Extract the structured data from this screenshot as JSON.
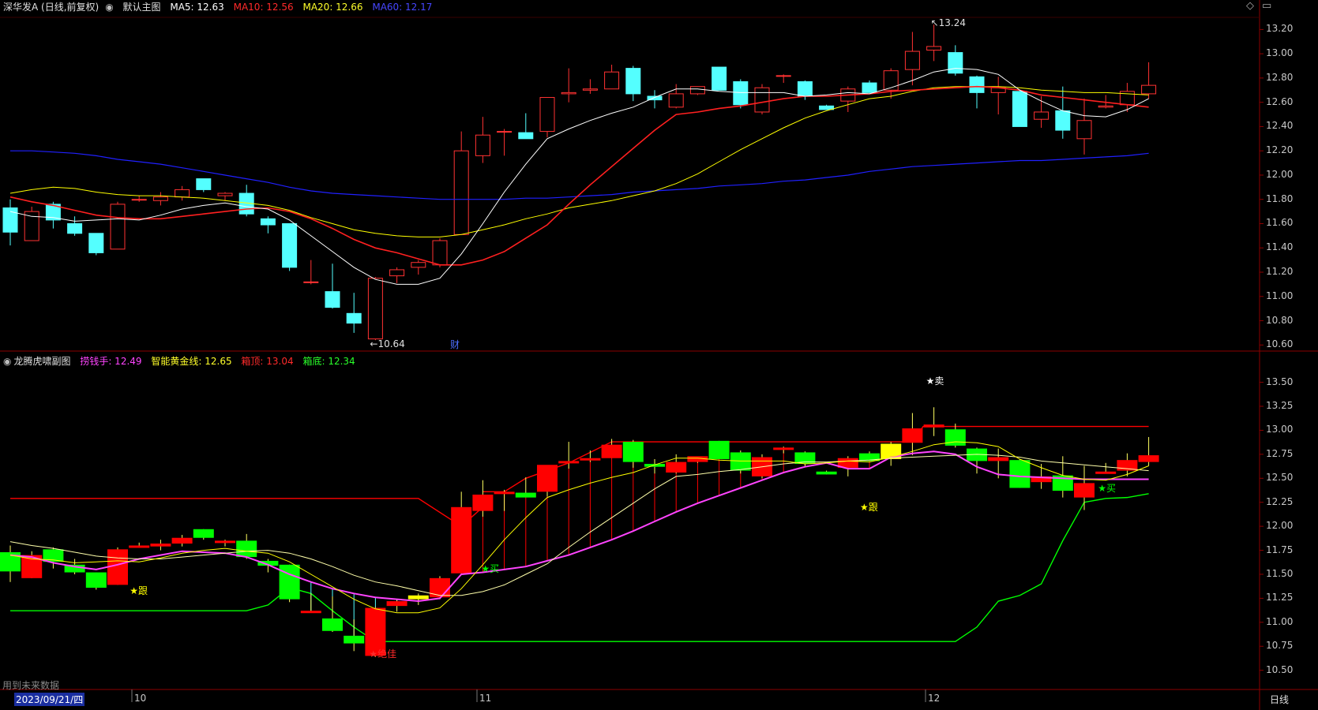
{
  "main_header": {
    "title": "深华发A (日线,前复权)",
    "main_chart_name": "默认主图",
    "ma5": "MA5: 12.63",
    "ma10": "MA10: 12.56",
    "ma20": "MA20: 12.66",
    "ma60": "MA60: 12.17"
  },
  "sub_header": {
    "title": "龙腾虎啸副图",
    "laoqianshou": "捞钱手: 12.49",
    "zhineng": "智能黄金线: 12.65",
    "xiangding": "箱顶: 13.04",
    "xiangdi": "箱底: 12.34"
  },
  "main_axis": [
    "13.20",
    "13.00",
    "12.80",
    "12.60",
    "12.40",
    "12.20",
    "12.00",
    "11.80",
    "11.60",
    "11.40",
    "11.20",
    "11.00",
    "10.80",
    "10.60"
  ],
  "sub_axis": [
    "13.50",
    "13.25",
    "13.00",
    "12.75",
    "12.50",
    "12.25",
    "12.00",
    "11.75",
    "11.50",
    "11.25",
    "11.00",
    "10.75",
    "10.50"
  ],
  "annotations": {
    "high": "13.24",
    "low": "10.64",
    "finance": "财",
    "sell": "★卖",
    "follow1": "★跟",
    "follow2": "★跟",
    "buy1": "★买",
    "buy2": "★买",
    "jueshai": "★绝佳"
  },
  "footer": {
    "future_data": "用到未来数据",
    "date": "2023/09/21/四",
    "month_10": "10",
    "month_11": "11",
    "month_12": "12",
    "period": "日线"
  },
  "colors": {
    "up": "#ff3232",
    "down": "#54ffff",
    "ma5": "#ffffff",
    "ma10": "#ff2020",
    "ma20": "#ffff00",
    "ma60": "#2020ff",
    "sub_up": "#ff0000",
    "sub_down": "#00ff00",
    "magenta": "#ff44ff",
    "grid": "#8b0000"
  },
  "chart_data": {
    "type": "candlestick",
    "candles": [
      {
        "o": 11.73,
        "h": 11.8,
        "l": 11.42,
        "c": 11.53
      },
      {
        "o": 11.46,
        "h": 11.74,
        "l": 11.46,
        "c": 11.7
      },
      {
        "o": 11.76,
        "h": 11.78,
        "l": 11.56,
        "c": 11.63
      },
      {
        "o": 11.6,
        "h": 11.66,
        "l": 11.5,
        "c": 11.52
      },
      {
        "o": 11.52,
        "h": 11.52,
        "l": 11.34,
        "c": 11.36
      },
      {
        "o": 11.39,
        "h": 11.78,
        "l": 11.39,
        "c": 11.76
      },
      {
        "o": 11.8,
        "h": 11.83,
        "l": 11.78,
        "c": 11.8
      },
      {
        "o": 11.79,
        "h": 11.86,
        "l": 11.75,
        "c": 11.82
      },
      {
        "o": 11.82,
        "h": 11.91,
        "l": 11.79,
        "c": 11.88
      },
      {
        "o": 11.97,
        "h": 11.97,
        "l": 11.86,
        "c": 11.88
      },
      {
        "o": 11.83,
        "h": 11.86,
        "l": 11.79,
        "c": 11.85
      },
      {
        "o": 11.85,
        "h": 11.92,
        "l": 11.66,
        "c": 11.68
      },
      {
        "o": 11.64,
        "h": 11.66,
        "l": 11.52,
        "c": 11.59
      },
      {
        "o": 11.6,
        "h": 11.6,
        "l": 11.21,
        "c": 11.24
      },
      {
        "o": 11.12,
        "h": 11.3,
        "l": 11.1,
        "c": 11.12
      },
      {
        "o": 11.04,
        "h": 11.27,
        "l": 10.9,
        "c": 10.91
      },
      {
        "o": 10.86,
        "h": 11.03,
        "l": 10.7,
        "c": 10.78
      },
      {
        "o": 10.65,
        "h": 11.16,
        "l": 10.64,
        "c": 11.15
      },
      {
        "o": 11.17,
        "h": 11.24,
        "l": 11.11,
        "c": 11.22
      },
      {
        "o": 11.24,
        "h": 11.3,
        "l": 11.18,
        "c": 11.28
      },
      {
        "o": 11.26,
        "h": 11.48,
        "l": 11.24,
        "c": 11.46
      },
      {
        "o": 11.51,
        "h": 12.36,
        "l": 11.51,
        "c": 12.2
      },
      {
        "o": 12.16,
        "h": 12.48,
        "l": 12.1,
        "c": 12.33
      },
      {
        "o": 12.36,
        "h": 12.38,
        "l": 12.16,
        "c": 12.36
      },
      {
        "o": 12.35,
        "h": 12.51,
        "l": 12.3,
        "c": 12.3
      },
      {
        "o": 12.36,
        "h": 12.63,
        "l": 12.31,
        "c": 12.64
      },
      {
        "o": 12.67,
        "h": 12.88,
        "l": 12.6,
        "c": 12.68
      },
      {
        "o": 12.7,
        "h": 12.79,
        "l": 12.67,
        "c": 12.71
      },
      {
        "o": 12.71,
        "h": 12.91,
        "l": 12.71,
        "c": 12.85
      },
      {
        "o": 12.88,
        "h": 12.9,
        "l": 12.61,
        "c": 12.67
      },
      {
        "o": 12.65,
        "h": 12.7,
        "l": 12.55,
        "c": 12.62
      },
      {
        "o": 12.56,
        "h": 12.75,
        "l": 12.55,
        "c": 12.67
      },
      {
        "o": 12.67,
        "h": 12.7,
        "l": 12.66,
        "c": 12.73
      },
      {
        "o": 12.89,
        "h": 12.89,
        "l": 12.7,
        "c": 12.7
      },
      {
        "o": 12.77,
        "h": 12.79,
        "l": 12.55,
        "c": 12.58
      },
      {
        "o": 12.52,
        "h": 12.75,
        "l": 12.5,
        "c": 12.72
      },
      {
        "o": 12.82,
        "h": 12.83,
        "l": 12.76,
        "c": 12.82
      },
      {
        "o": 12.77,
        "h": 12.78,
        "l": 12.62,
        "c": 12.65
      },
      {
        "o": 12.57,
        "h": 12.58,
        "l": 12.54,
        "c": 12.54
      },
      {
        "o": 12.61,
        "h": 12.73,
        "l": 12.52,
        "c": 12.71
      },
      {
        "o": 12.76,
        "h": 12.78,
        "l": 12.68,
        "c": 12.68
      },
      {
        "o": 12.7,
        "h": 12.88,
        "l": 12.63,
        "c": 12.86
      },
      {
        "o": 12.87,
        "h": 13.18,
        "l": 12.74,
        "c": 13.02
      },
      {
        "o": 13.03,
        "h": 13.24,
        "l": 12.94,
        "c": 13.06
      },
      {
        "o": 13.01,
        "h": 13.07,
        "l": 12.82,
        "c": 12.84
      },
      {
        "o": 12.81,
        "h": 12.82,
        "l": 12.55,
        "c": 12.68
      },
      {
        "o": 12.68,
        "h": 12.81,
        "l": 12.5,
        "c": 12.72
      },
      {
        "o": 12.69,
        "h": 12.7,
        "l": 12.4,
        "c": 12.4
      },
      {
        "o": 12.46,
        "h": 12.65,
        "l": 12.39,
        "c": 12.52
      },
      {
        "o": 12.53,
        "h": 12.73,
        "l": 12.3,
        "c": 12.37
      },
      {
        "o": 12.3,
        "h": 12.63,
        "l": 12.17,
        "c": 12.45
      },
      {
        "o": 12.56,
        "h": 12.66,
        "l": 12.55,
        "c": 12.57
      },
      {
        "o": 12.58,
        "h": 12.76,
        "l": 12.52,
        "c": 12.69
      },
      {
        "o": 12.67,
        "h": 12.93,
        "l": 12.63,
        "c": 12.74
      }
    ],
    "ma5": [
      11.7,
      11.66,
      11.65,
      11.62,
      11.63,
      11.64,
      11.63,
      11.67,
      11.72,
      11.75,
      11.77,
      11.74,
      11.72,
      11.63,
      11.5,
      11.37,
      11.24,
      11.14,
      11.1,
      11.1,
      11.15,
      11.35,
      11.6,
      11.86,
      12.09,
      12.3,
      12.38,
      12.45,
      12.51,
      12.56,
      12.64,
      12.71,
      12.71,
      12.69,
      12.68,
      12.68,
      12.68,
      12.65,
      12.66,
      12.68,
      12.67,
      12.72,
      12.78,
      12.85,
      12.88,
      12.87,
      12.83,
      12.7,
      12.61,
      12.53,
      12.49,
      12.48,
      12.54,
      12.63
    ],
    "ma10": [
      11.82,
      11.78,
      11.75,
      11.71,
      11.67,
      11.65,
      11.64,
      11.64,
      11.66,
      11.68,
      11.7,
      11.72,
      11.73,
      11.7,
      11.64,
      11.56,
      11.47,
      11.4,
      11.36,
      11.31,
      11.26,
      11.26,
      11.3,
      11.37,
      11.48,
      11.59,
      11.76,
      11.92,
      12.07,
      12.22,
      12.37,
      12.5,
      12.52,
      12.55,
      12.57,
      12.6,
      12.63,
      12.65,
      12.65,
      12.66,
      12.67,
      12.69,
      12.7,
      12.71,
      12.72,
      12.73,
      12.72,
      12.7,
      12.66,
      12.64,
      12.62,
      12.6,
      12.58,
      12.56
    ],
    "ma20": [
      11.85,
      11.88,
      11.9,
      11.89,
      11.86,
      11.84,
      11.83,
      11.83,
      11.82,
      11.81,
      11.79,
      11.77,
      11.75,
      11.71,
      11.65,
      11.6,
      11.55,
      11.52,
      11.5,
      11.49,
      11.49,
      11.51,
      11.55,
      11.59,
      11.64,
      11.68,
      11.73,
      11.76,
      11.79,
      11.83,
      11.87,
      11.93,
      12.01,
      12.11,
      12.21,
      12.3,
      12.39,
      12.47,
      12.53,
      12.58,
      12.63,
      12.65,
      12.69,
      12.72,
      12.73,
      12.73,
      12.73,
      12.72,
      12.7,
      12.69,
      12.68,
      12.68,
      12.67,
      12.66
    ],
    "ma60": [
      12.2,
      12.2,
      12.19,
      12.18,
      12.16,
      12.13,
      12.11,
      12.09,
      12.06,
      12.03,
      12.0,
      11.97,
      11.94,
      11.9,
      11.87,
      11.85,
      11.84,
      11.83,
      11.82,
      11.81,
      11.8,
      11.8,
      11.8,
      11.8,
      11.81,
      11.81,
      11.82,
      11.83,
      11.84,
      11.86,
      11.87,
      11.88,
      11.89,
      11.91,
      11.92,
      11.93,
      11.95,
      11.96,
      11.98,
      12.0,
      12.03,
      12.05,
      12.07,
      12.08,
      12.09,
      12.1,
      12.11,
      12.12,
      12.12,
      12.13,
      12.14,
      12.15,
      12.16,
      12.18
    ],
    "main_ylim": [
      10.55,
      13.3
    ],
    "sub_ylim": [
      10.3,
      13.62
    ],
    "box_top": {
      "left_value": 12.29,
      "right_value": 13.04,
      "step_index": 20
    },
    "box_bottom": {
      "left_value": 11.12,
      "low_value": 10.8,
      "right_value": 12.34
    }
  }
}
